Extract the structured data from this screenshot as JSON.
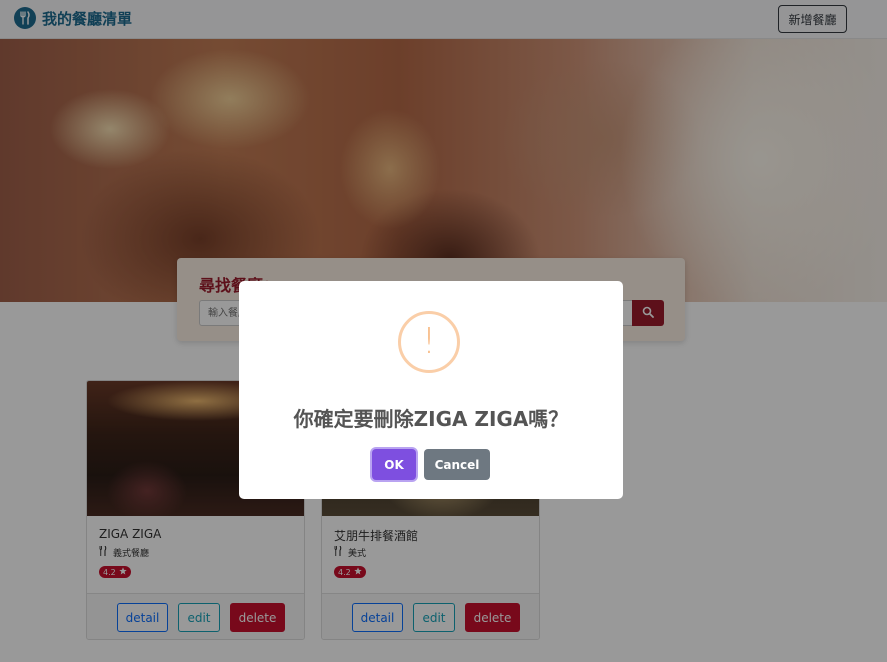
{
  "navbar": {
    "brand_text": "我的餐廳清單",
    "new_button_label": "新增餐廳"
  },
  "search": {
    "title": "尋找餐廳：",
    "placeholder": "輸入餐廳、分類"
  },
  "restaurants": [
    {
      "name": "ZIGA ZIGA",
      "category": "義式餐廳",
      "rating": "4.2",
      "detail_label": "detail",
      "edit_label": "edit",
      "delete_label": "delete"
    },
    {
      "name": "艾朋牛排餐酒館",
      "category": "美式",
      "rating": "4.2",
      "detail_label": "detail",
      "edit_label": "edit",
      "delete_label": "delete"
    }
  ],
  "modal": {
    "icon": "!",
    "title": "你確定要刪除ZIGA ZIGA嗎？",
    "ok_label": "OK",
    "cancel_label": "Cancel"
  },
  "colors": {
    "brand": "#1d6b8f",
    "search_accent": "#9b1c2c",
    "rating_badge": "#c8102e",
    "ok_button": "#7e4fe0",
    "cancel_button": "#6e7881",
    "warning": "#f8bb86"
  },
  "icons": {
    "brand": "utensils-icon",
    "search": "search-icon",
    "category": "utensils-icon",
    "rating": "star-icon"
  }
}
